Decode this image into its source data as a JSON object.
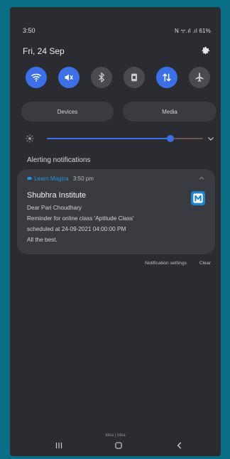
{
  "status_bar": {
    "time": "3:50",
    "right_text": "N  ᯤ.ıl .ıl 61%"
  },
  "header": {
    "date": "Fri, 24 Sep"
  },
  "quick_settings": {
    "toggles": [
      {
        "name": "wifi-icon",
        "state": "on"
      },
      {
        "name": "mute-icon",
        "state": "on"
      },
      {
        "name": "bluetooth-icon",
        "state": "off"
      },
      {
        "name": "rotation-lock-icon",
        "state": "off"
      },
      {
        "name": "mobile-data-icon",
        "state": "on"
      },
      {
        "name": "airplane-mode-icon",
        "state": "off"
      }
    ],
    "pills": [
      "Devices",
      "Media"
    ],
    "brightness_level": 0.79,
    "colors": {
      "on": "#3d6fe6",
      "off": "#4a4b51"
    }
  },
  "notifications": {
    "section_title": "Alerting notifications",
    "items": [
      {
        "app_name": "Learn Magica",
        "time": "3:50 pm",
        "title": "Shubhra Institute",
        "lines": [
          "Dear Pari Choudhary",
          "Reminder for online class 'Aptitude Class'",
          "scheduled at 24-09-2021 04:00:00 PM",
          "All the best."
        ]
      }
    ],
    "actions": {
      "settings": "Notification settings",
      "clear": "Clear"
    }
  },
  "footer": {
    "carrier": "Idea | Idea"
  },
  "navigation": {
    "buttons": [
      "recent-apps-icon",
      "home-icon",
      "back-icon"
    ]
  }
}
